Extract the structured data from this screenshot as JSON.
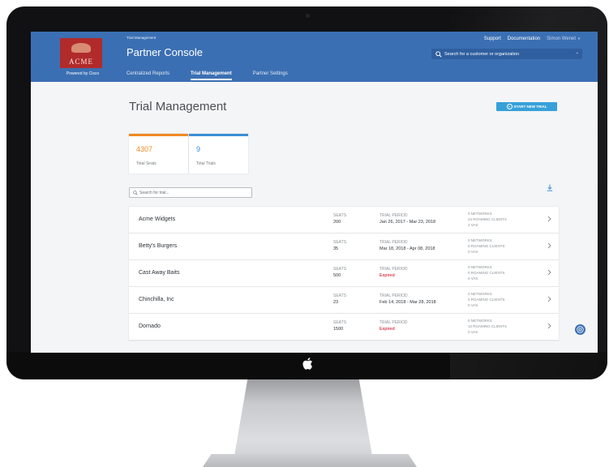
{
  "header": {
    "breadcrumb": "Trial Management",
    "title": "Partner Console",
    "logo_text": "ACME",
    "powered_by": "Powered by Cisco",
    "links": {
      "support": "Support",
      "documentation": "Documentation"
    },
    "user_name": "Simon Wenet",
    "search_placeholder": "Search for a customer or organization",
    "nav_tabs": [
      {
        "label": "Centralized Reports",
        "active": false
      },
      {
        "label": "Trial Management",
        "active": true
      },
      {
        "label": "Partner Settings",
        "active": false
      }
    ]
  },
  "page": {
    "title": "Trial Management",
    "start_button_label": "START NEW TRIAL",
    "search_placeholder": "Search for trial..."
  },
  "stats": [
    {
      "value": "4307",
      "label": "Total Seats",
      "color": "#f08a24"
    },
    {
      "value": "9",
      "label": "Total Trials",
      "color": "#3b8fd4"
    }
  ],
  "trials": [
    {
      "name": "Acme Widgets",
      "seats_label": "SEATS",
      "seats": "200",
      "period_label": "TRIAL PERIOD",
      "period": "Jan 26, 2017 - Mar 23, 2018",
      "expired": false,
      "networks": "0 NETWORKS",
      "roaming": "24 ROAMING CLIENTS",
      "vas": "2 VAS"
    },
    {
      "name": "Betty's Burgers",
      "seats_label": "SEATS",
      "seats": "35",
      "period_label": "TRIAL PERIOD",
      "period": "Mar 18, 2018 - Apr 08, 2018",
      "expired": false,
      "networks": "0 NETWORKS",
      "roaming": "0 ROAMING CLIENTS",
      "vas": "0 VAS"
    },
    {
      "name": "Cast Away Baits",
      "seats_label": "SEATS",
      "seats": "500",
      "period_label": "TRIAL PERIOD",
      "period": "Expired",
      "expired": true,
      "networks": "0 NETWORKS",
      "roaming": "0 ROAMING CLIENTS",
      "vas": "0 VAS"
    },
    {
      "name": "Chinchilla, Inc",
      "seats_label": "SEATS",
      "seats": "23",
      "period_label": "TRIAL PERIOD",
      "period": "Feb 14, 2018 - Mar 28, 2018",
      "expired": false,
      "networks": "0 NETWORKS",
      "roaming": "0 ROAMING CLIENTS",
      "vas": "0 VAS"
    },
    {
      "name": "Dornado",
      "seats_label": "SEATS",
      "seats": "1500",
      "period_label": "TRIAL PERIOD",
      "period": "Expired",
      "expired": true,
      "networks": "0 NETWORKS",
      "roaming": "10 ROAMING CLIENTS",
      "vas": "0 VAS"
    }
  ],
  "colors": {
    "header_bg": "#3b6fb3",
    "accent_button": "#37a0d9",
    "expired": "#d0021b"
  },
  "icons": [
    "apple-logo-icon",
    "search-icon",
    "download-icon",
    "chevron-right-icon",
    "help-icon",
    "plus-circle-icon",
    "caret-down-icon"
  ]
}
